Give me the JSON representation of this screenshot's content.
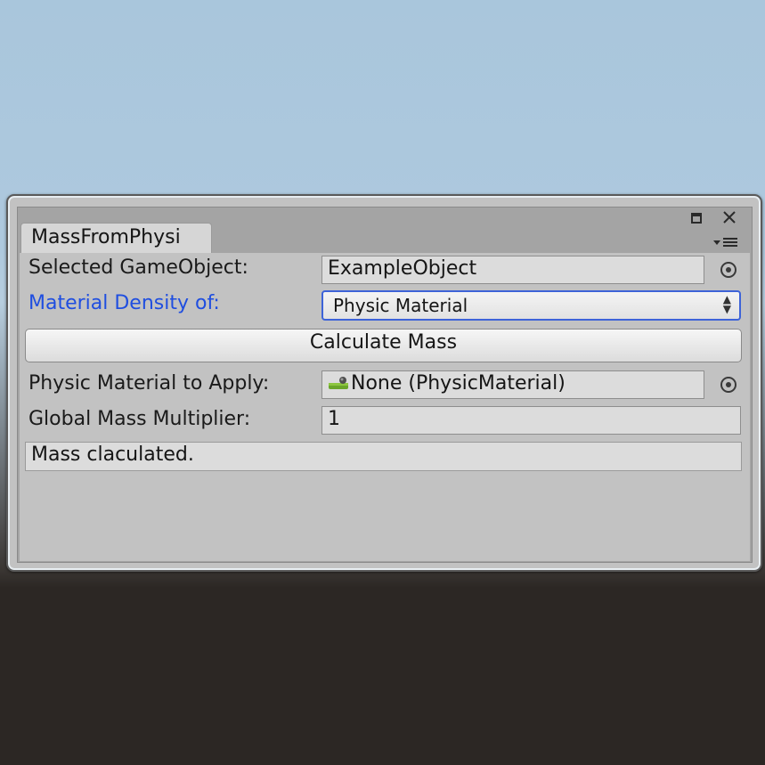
{
  "window": {
    "tab_title": "MassFromPhysi"
  },
  "form": {
    "selected_gameobject_label": "Selected GameObject:",
    "selected_gameobject_value": "ExampleObject",
    "material_density_label": "Material Density of:",
    "material_density_value": "Physic Material",
    "calculate_button_label": "Calculate Mass",
    "physic_material_label": "Physic Material to Apply:",
    "physic_material_value": "None (PhysicMaterial)",
    "global_mass_label": "Global Mass Multiplier:",
    "global_mass_value": "1",
    "status_message": "Mass claculated."
  },
  "icons": {
    "maximize": "maximize-icon",
    "close": "close-icon",
    "window_menu": "window-menu-icon",
    "object_picker": "object-picker-icon",
    "physic_material": "physic-material-icon",
    "dropdown_arrows": "dropdown-arrows-icon"
  },
  "colors": {
    "highlight_label": "#1f4ee0",
    "dropdown_focus_border": "#3d63d8",
    "panel_background": "#c2c2c2"
  }
}
